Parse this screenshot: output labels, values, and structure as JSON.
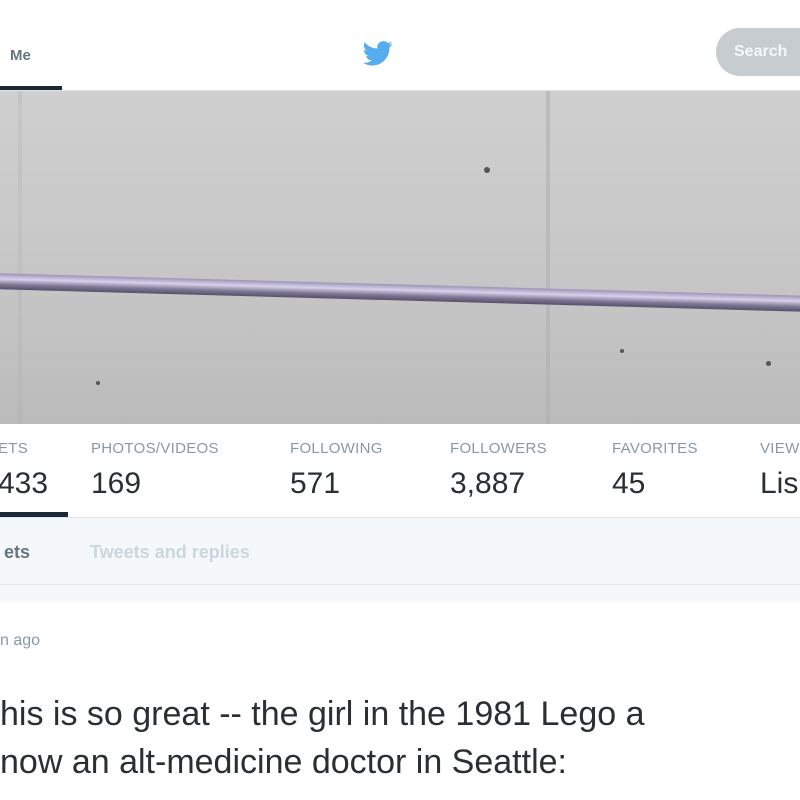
{
  "nav": {
    "me_label": "Me",
    "search_placeholder": "Search"
  },
  "stats": [
    {
      "label": "ETS",
      "value": "433"
    },
    {
      "label": "PHOTOS/VIDEOS",
      "value": "169"
    },
    {
      "label": "FOLLOWING",
      "value": "571"
    },
    {
      "label": "FOLLOWERS",
      "value": "3,887"
    },
    {
      "label": "FAVORITES",
      "value": "45"
    },
    {
      "label": "VIEW",
      "value": "Lis"
    }
  ],
  "tabs": {
    "tweets": "ets",
    "replies": "Tweets and replies"
  },
  "tweet": {
    "time": "n ago",
    "line1": "his is so great -- the girl in the 1981 Lego a",
    "line2": "now an alt-medicine doctor in Seattle:"
  },
  "colors": {
    "twitter_blue": "#55acee",
    "active_tab": "#1b2836"
  },
  "icons": {
    "logo": "twitter-bird-icon"
  }
}
